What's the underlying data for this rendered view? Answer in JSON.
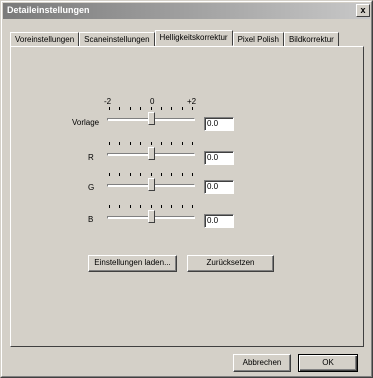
{
  "window": {
    "title": "Detaileinstellungen",
    "close_label": "x"
  },
  "tabs": [
    {
      "label": "Voreinstellungen",
      "active": false
    },
    {
      "label": "Scaneinstellungen",
      "active": false
    },
    {
      "label": "Helligkeitskorrektur",
      "active": true
    },
    {
      "label": "Pixel Polish",
      "active": false
    },
    {
      "label": "Bildkorrektur",
      "active": false
    }
  ],
  "scale": {
    "min_label": "-2",
    "mid_label": "0",
    "max_label": "+2"
  },
  "sliders": [
    {
      "label": "Vorlage",
      "value": "0.0",
      "position": 0.5
    },
    {
      "label": "R",
      "value": "0.0",
      "position": 0.5
    },
    {
      "label": "G",
      "value": "0.0",
      "position": 0.5
    },
    {
      "label": "B",
      "value": "0.0",
      "position": 0.5
    }
  ],
  "buttons": {
    "load_label": "Einstellungen laden...",
    "reset_label": "Zurücksetzen",
    "cancel_label": "Abbrechen",
    "ok_label": "OK"
  }
}
